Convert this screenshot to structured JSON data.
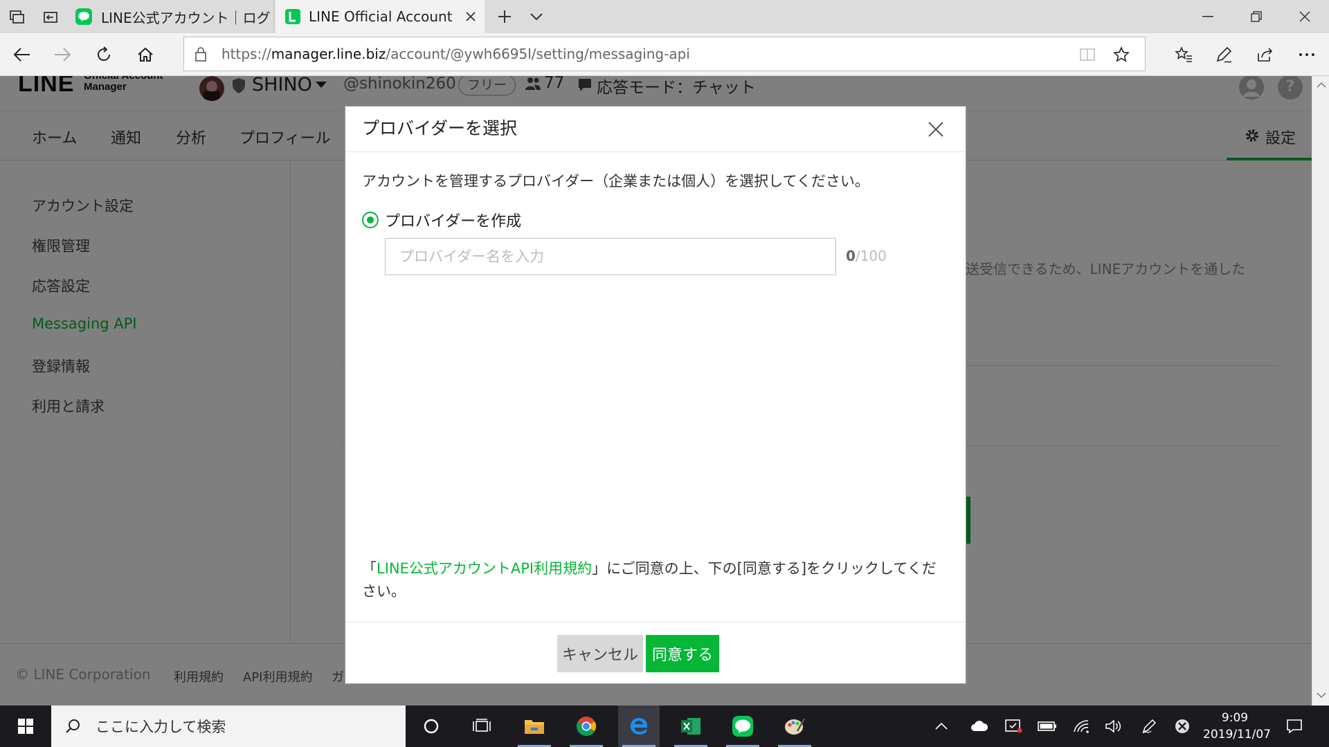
{
  "browser": {
    "tabs": [
      {
        "label": "LINE公式アカウント｜ログイン画"
      },
      {
        "label": "LINE Official Account M"
      }
    ],
    "url_scheme": "https://",
    "url_host": "manager.line.biz",
    "url_path": "/account/@ywh6695l/setting/messaging-api"
  },
  "header": {
    "logo_line": "LINE",
    "logo_sub1": "Official Account",
    "logo_sub2": "Manager",
    "account_name": "SHINO",
    "account_id": "@shinokin260",
    "plan_badge": "フリー",
    "friends_count": "77",
    "response_mode": "応答モード：チャット"
  },
  "nav": {
    "items": [
      "ホーム",
      "通知",
      "分析",
      "プロフィール"
    ],
    "settings": "設定"
  },
  "sidebar": {
    "items": [
      "アカウント設定",
      "権限管理",
      "応答設定",
      "Messaging API",
      "登録情報",
      "利用と請求"
    ],
    "active_index": 3
  },
  "main": {
    "partial_text": "送受信できるため、LINEアカウントを通した"
  },
  "footer": {
    "copyright": "© LINE Corporation",
    "links": [
      "利用規約",
      "API利用規約",
      "ガ"
    ]
  },
  "modal": {
    "title": "プロバイダーを選択",
    "description": "アカウントを管理するプロバイダー（企業または個人）を選択してください。",
    "radio_label": "プロバイダーを作成",
    "input_placeholder": "プロバイダー名を入力",
    "char_count_current": "0",
    "char_count_max": "/100",
    "terms_prefix": "「",
    "terms_link": "LINE公式アカウントAPI利用規約",
    "terms_suffix": "」にご同意の上、下の[同意する]をクリックしてください。",
    "cancel_label": "キャンセル",
    "agree_label": "同意する"
  },
  "taskbar": {
    "search_placeholder": "ここに入力して検索",
    "time": "9:09",
    "date": "2019/11/07"
  },
  "colors": {
    "line_green": "#06b637",
    "overlay": "rgba(0,0,0,0.5)"
  }
}
